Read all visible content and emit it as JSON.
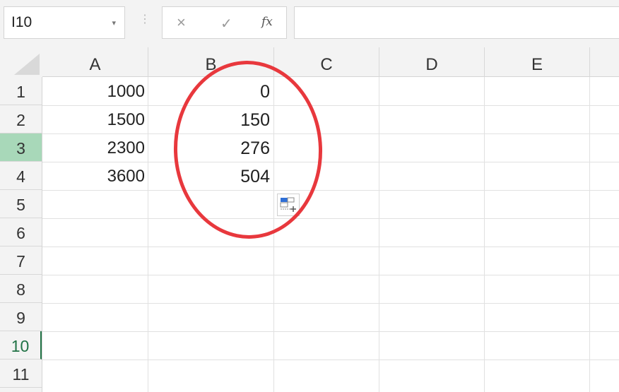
{
  "formula_bar": {
    "name_box": "I10",
    "cancel_icon": "×",
    "enter_icon": "✓",
    "function_icon": "fx",
    "formula": ""
  },
  "columns": [
    "A",
    "B",
    "C",
    "D",
    "E"
  ],
  "rows": [
    "1",
    "2",
    "3",
    "4",
    "5",
    "6",
    "7",
    "8",
    "9",
    "10",
    "11"
  ],
  "cells": {
    "A1": "1000",
    "A2": "1500",
    "A3": "2300",
    "A4": "3600",
    "B1": "0",
    "B2": "150",
    "B3": "276",
    "B4": "504"
  },
  "selection": {
    "selected_row": "3",
    "active_row": "10"
  },
  "colors": {
    "selected_row_header": "#a8d8b9",
    "active_accent": "#217346",
    "annotation_ellipse": "#e8383d"
  }
}
